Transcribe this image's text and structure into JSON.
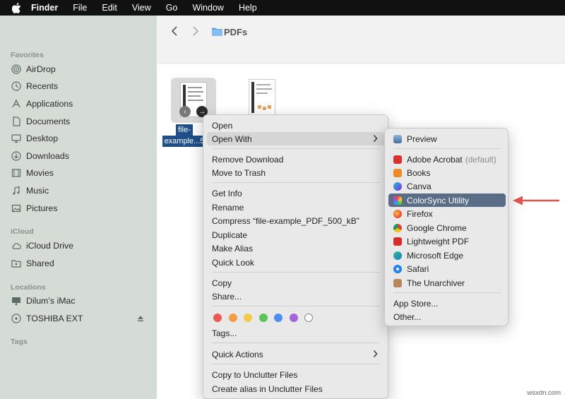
{
  "menubar": {
    "items": [
      "Finder",
      "File",
      "Edit",
      "View",
      "Go",
      "Window",
      "Help"
    ]
  },
  "sidebar": {
    "favorites_label": "Favorites",
    "favorites": [
      {
        "label": "AirDrop",
        "icon": "airdrop-icon"
      },
      {
        "label": "Recents",
        "icon": "clock-icon"
      },
      {
        "label": "Applications",
        "icon": "applications-icon"
      },
      {
        "label": "Documents",
        "icon": "document-icon"
      },
      {
        "label": "Desktop",
        "icon": "desktop-icon"
      },
      {
        "label": "Downloads",
        "icon": "download-icon"
      },
      {
        "label": "Movies",
        "icon": "film-icon"
      },
      {
        "label": "Music",
        "icon": "music-note-icon"
      },
      {
        "label": "Pictures",
        "icon": "photo-icon"
      }
    ],
    "icloud_label": "iCloud",
    "icloud": [
      {
        "label": "iCloud Drive",
        "icon": "cloud-icon"
      },
      {
        "label": "Shared",
        "icon": "shared-folder-icon"
      }
    ],
    "locations_label": "Locations",
    "locations": [
      {
        "label": "Dilum’s iMac",
        "icon": "imac-icon"
      },
      {
        "label": "TOSHIBA EXT",
        "icon": "drive-icon"
      }
    ],
    "tags_label": "Tags"
  },
  "toolbar": {
    "title": "PDFs"
  },
  "files": {
    "selected_label_line1": "file-",
    "selected_label_line2": "example...5"
  },
  "context_menu": {
    "open": "Open",
    "open_with": "Open With",
    "remove_download": "Remove Download",
    "move_to_trash": "Move to Trash",
    "get_info": "Get Info",
    "rename": "Rename",
    "compress": "Compress “file-example_PDF_500_kB”",
    "duplicate": "Duplicate",
    "make_alias": "Make Alias",
    "quick_look": "Quick Look",
    "copy": "Copy",
    "share": "Share...",
    "tags": "Tags...",
    "quick_actions": "Quick Actions",
    "copy_to_unclutter": "Copy to Unclutter Files",
    "create_alias_unclutter": "Create alias in Unclutter Files",
    "tag_colors": [
      "#ea5a51",
      "#f0a043",
      "#f3ca4a",
      "#5ec25a",
      "#4d8ff0",
      "#a465d6",
      "#ffffff"
    ]
  },
  "open_with_menu": {
    "preview": "Preview",
    "adobe_acrobat": "Adobe Acrobat",
    "default_note": "(default)",
    "books": "Books",
    "canva": "Canva",
    "colorsync": "ColorSync Utility",
    "firefox": "Firefox",
    "chrome": "Google Chrome",
    "lightweight_pdf": "Lightweight PDF",
    "edge": "Microsoft Edge",
    "safari": "Safari",
    "unarchiver": "The Unarchiver",
    "app_store": "App Store...",
    "other": "Other...",
    "selected_color": "#5a6d86"
  },
  "watermark": "wsxdn.com",
  "accent": {
    "selection": "#1f4f86",
    "arrow": "#e0524a"
  }
}
